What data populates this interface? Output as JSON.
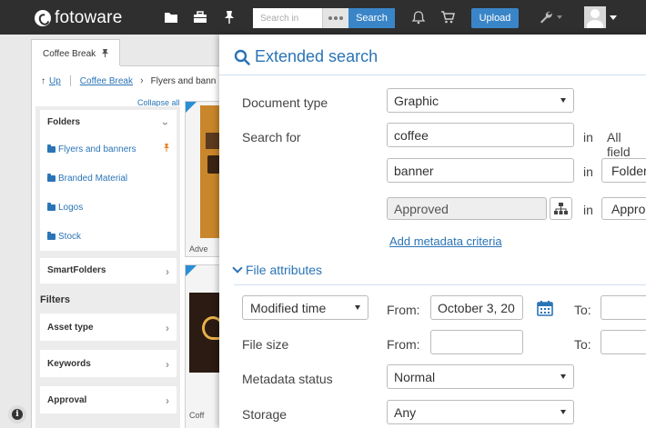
{
  "topbar": {
    "logo_text": "fotoware",
    "search_placeholder": "Search in",
    "search_button": "Search",
    "upload_button": "Upload"
  },
  "left": {
    "tab_label": "Coffee Break",
    "breadcrumb": {
      "up": "Up",
      "parent": "Coffee Break",
      "current": "Flyers and bann"
    },
    "collapse_all": "Collapse all",
    "folders_title": "Folders",
    "folders": [
      "Flyers and banners",
      "Branded Material",
      "Logos",
      "Stock"
    ],
    "smartfolders_title": "SmartFolders",
    "filters_title": "Filters",
    "filters": [
      "Asset type",
      "Keywords",
      "Approval"
    ],
    "thumbs": [
      {
        "label": "Adve",
        "color": "#c9862a"
      },
      {
        "label": "Coff",
        "color": "#2b1b12"
      }
    ]
  },
  "ext": {
    "title": "Extended search",
    "document_type": {
      "label": "Document type",
      "value": "Graphic"
    },
    "search_for": {
      "label": "Search for",
      "in": "in",
      "rows": [
        {
          "value": "coffee",
          "scope": "All field"
        },
        {
          "value": "banner",
          "scope": "Folder"
        },
        {
          "value": "Approved",
          "scope": "Appro"
        }
      ]
    },
    "add_metadata": "Add metadata criteria",
    "file_attributes_title": "File attributes",
    "modified": {
      "select": "Modified time",
      "from_label": "From:",
      "from_value": "October 3, 20",
      "to_label": "To:"
    },
    "file_size": {
      "label": "File size",
      "from_label": "From:",
      "to_label": "To:"
    },
    "metadata_status": {
      "label": "Metadata status",
      "value": "Normal"
    },
    "storage": {
      "label": "Storage",
      "value": "Any"
    },
    "accent": "#2a74b6"
  }
}
